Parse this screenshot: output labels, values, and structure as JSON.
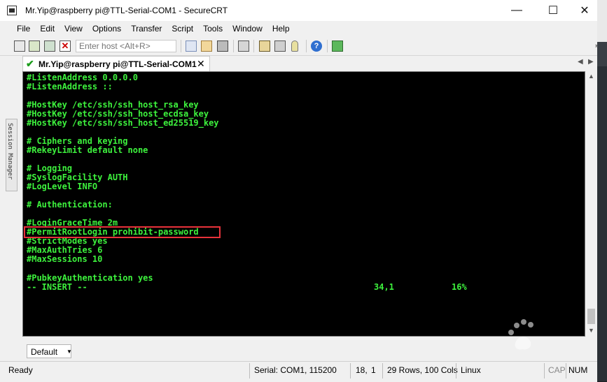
{
  "window": {
    "title": "Mr.Yip@raspberry pi@TTL-Serial-COM1 - SecureCRT",
    "minimize": "—",
    "maximize": "☐",
    "close": "✕"
  },
  "menu": [
    "File",
    "Edit",
    "View",
    "Options",
    "Transfer",
    "Script",
    "Tools",
    "Window",
    "Help"
  ],
  "toolbar": {
    "host_placeholder": "Enter host <Alt+R>",
    "overflow": "»"
  },
  "sidebar": {
    "label": "Session Manager"
  },
  "tabs": [
    {
      "label": "Mr.Yip@raspberry pi@TTL-Serial-COM1",
      "status_icon": "✔",
      "close": "✕"
    }
  ],
  "tab_nav": {
    "left": "◀",
    "right": "▶"
  },
  "terminal": {
    "lines": [
      "#ListenAddress 0.0.0.0",
      "#ListenAddress ::",
      "",
      "#HostKey /etc/ssh/ssh_host_rsa_key",
      "#HostKey /etc/ssh/ssh_host_ecdsa_key",
      "#HostKey /etc/ssh/ssh_host_ed25519_key",
      "",
      "# Ciphers and keying",
      "#RekeyLimit default none",
      "",
      "# Logging",
      "#SyslogFacility AUTH",
      "#LogLevel INFO",
      "",
      "# Authentication:",
      "",
      "#LoginGraceTime 2m",
      "#PermitRootLogin prohibit-password",
      "#StrictModes yes",
      "#MaxAuthTries 6",
      "#MaxSessions 10",
      "",
      "#PubkeyAuthentication yes",
      "-- INSERT --"
    ],
    "cursor_pos": "34,1",
    "percent": "16%",
    "highlight_color": "#e8323a",
    "text_color": "#3df23d"
  },
  "cmdbar": {
    "session_select": "Default"
  },
  "status": {
    "ready": "Ready",
    "serial": "Serial: COM1, 115200",
    "cursor_row": "18,",
    "cursor_col": "1",
    "size": "29 Rows, 100 Cols",
    "os": "Linux",
    "cap": "CAP",
    "num": "NUM"
  }
}
